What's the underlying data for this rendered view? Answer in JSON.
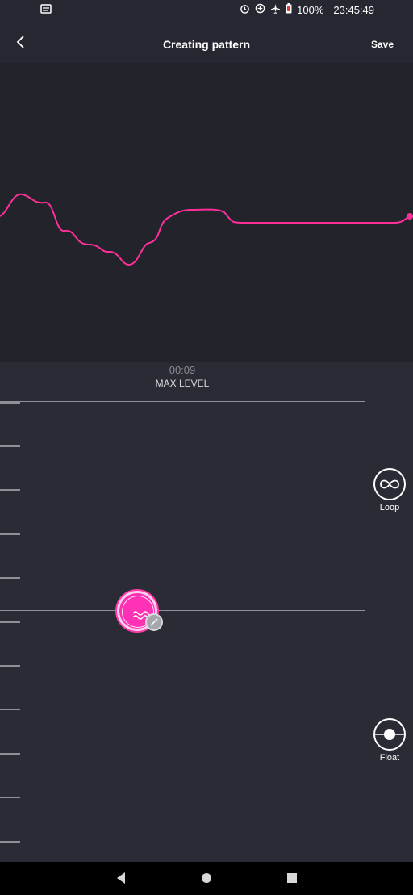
{
  "status_bar": {
    "battery_text": "100%",
    "time": "23:45:49",
    "icons": [
      "notification-icon",
      "alarm-icon",
      "data-saver-icon",
      "airplane-mode-icon",
      "battery-icon"
    ]
  },
  "header": {
    "title": "Creating pattern",
    "save_label": "Save"
  },
  "graph": {
    "line_color": "#ff2f9a"
  },
  "editor": {
    "time": "00:09",
    "level_label": "MAX LEVEL",
    "tick_count": 11
  },
  "side_panel": {
    "loop_label": "Loop",
    "float_label": "Float"
  },
  "accent_color": "#ff2fb3"
}
